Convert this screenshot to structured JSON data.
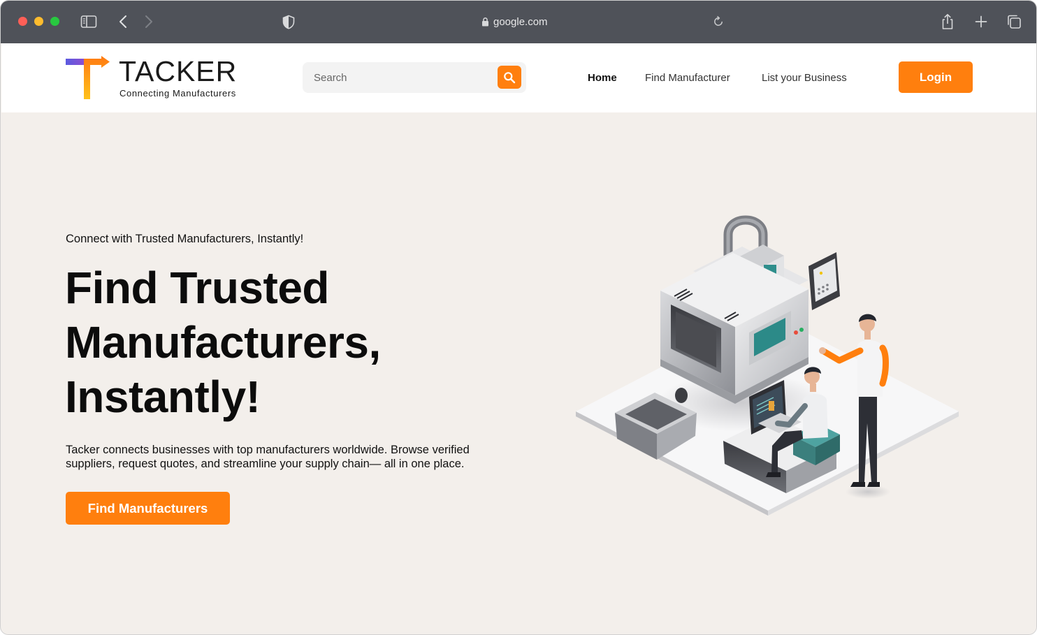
{
  "browser": {
    "url": "google.com"
  },
  "header": {
    "logo_title": "TACKER",
    "logo_subtitle": "Connecting Manufacturers",
    "search_placeholder": "Search",
    "nav": {
      "home": "Home",
      "find_manufacturer": "Find Manufacturer",
      "list_business": "List your Business"
    },
    "login_label": "Login"
  },
  "hero": {
    "tagline": "Connect with Trusted Manufacturers, Instantly!",
    "headline_line1": "Find Trusted",
    "headline_line2": "Manufacturers,",
    "headline_line3": "Instantly!",
    "description": "Tacker connects businesses with top manufacturers worldwide. Browse verified suppliers, request quotes, and streamline your supply chain— all in one place.",
    "cta_label": "Find Manufacturers"
  },
  "colors": {
    "accent": "#ff7f0e",
    "hero_bg": "#f3efeb",
    "chrome_bg": "#4f5259",
    "logo_purple": "#6a4fd8"
  },
  "icons": {
    "sidebar": "sidebar-icon",
    "back": "chevron-left-icon",
    "forward": "chevron-right-icon",
    "privacy": "shield-icon",
    "lock": "lock-icon",
    "reload": "reload-icon",
    "share": "share-icon",
    "new_tab": "plus-icon",
    "tabs": "tabs-overview-icon",
    "search": "search-icon"
  }
}
